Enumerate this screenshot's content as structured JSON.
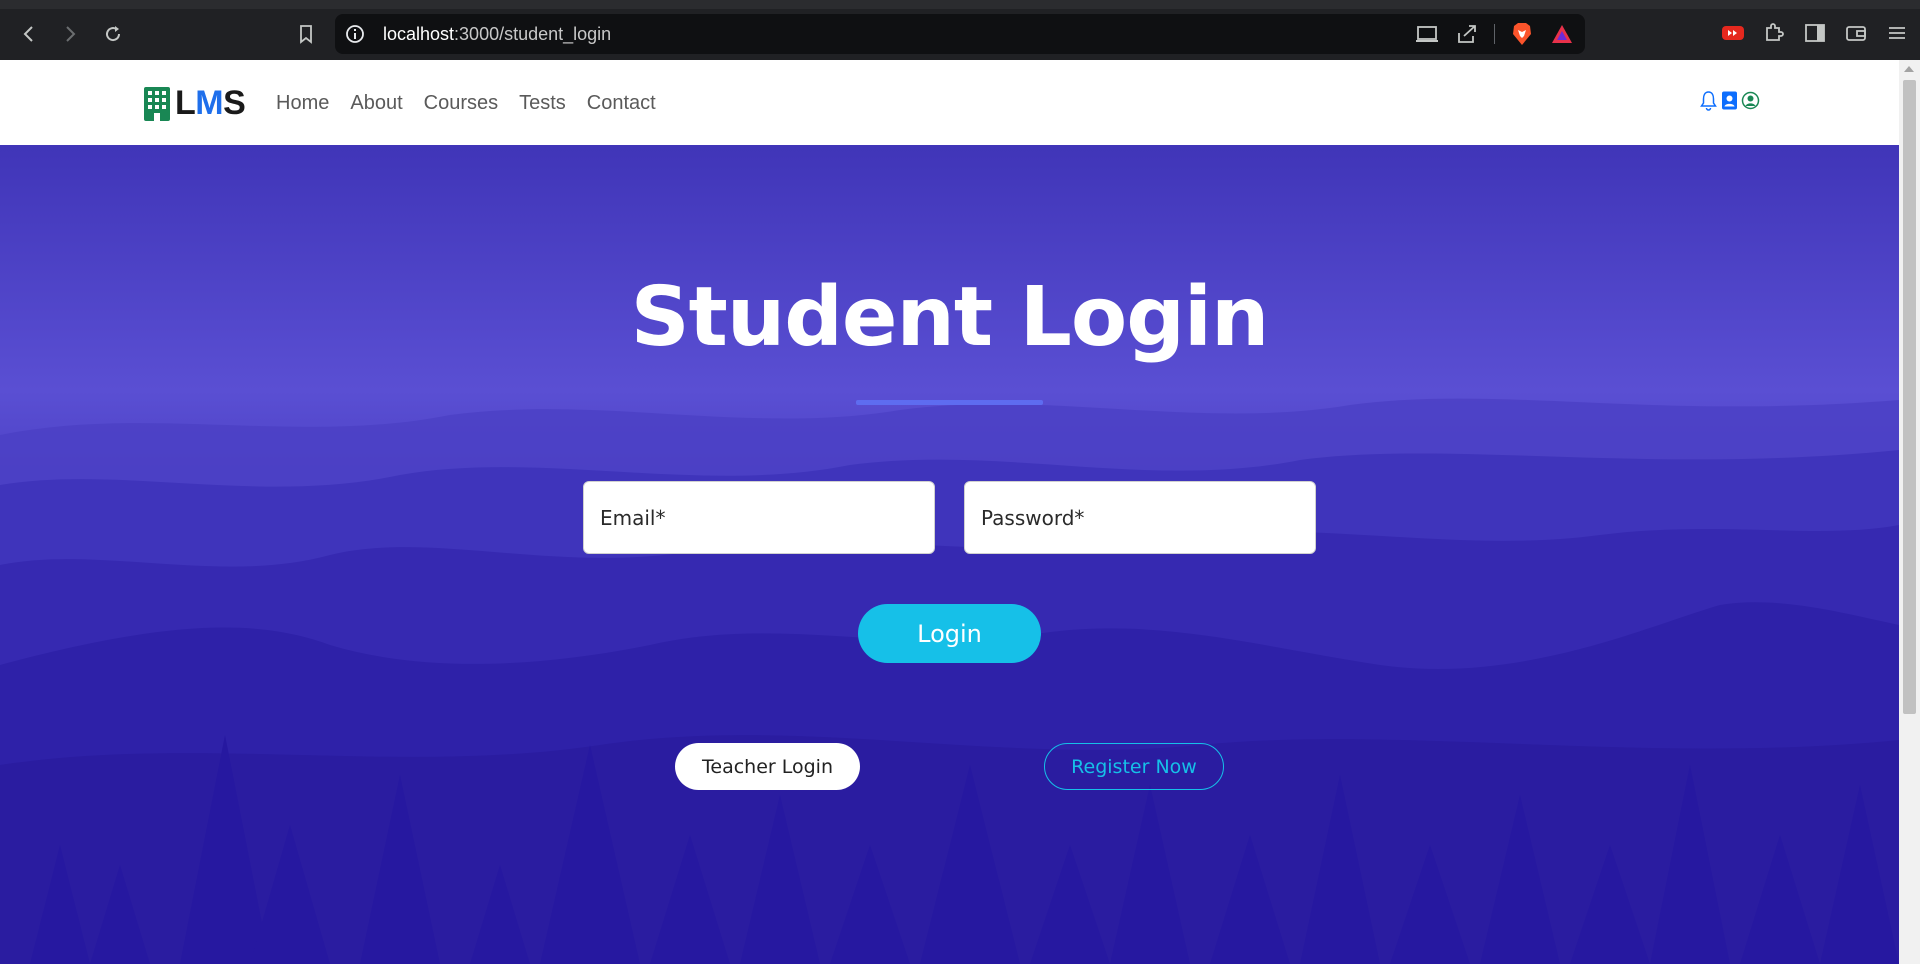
{
  "browser": {
    "url_host": "localhost",
    "url_path": ":3000/student_login"
  },
  "navbar": {
    "brand": {
      "l": "L",
      "m": "M",
      "s": "S"
    },
    "links": [
      "Home",
      "About",
      "Courses",
      "Tests",
      "Contact"
    ]
  },
  "hero": {
    "title": "Student Login",
    "email_placeholder": "Email*",
    "password_placeholder": "Password*",
    "login_label": "Login",
    "teacher_login_label": "Teacher Login",
    "register_label": "Register Now"
  },
  "colors": {
    "accent": "#16c0e8",
    "brand_blue": "#1f6feb",
    "hero_bg": "#2a1fa0"
  }
}
